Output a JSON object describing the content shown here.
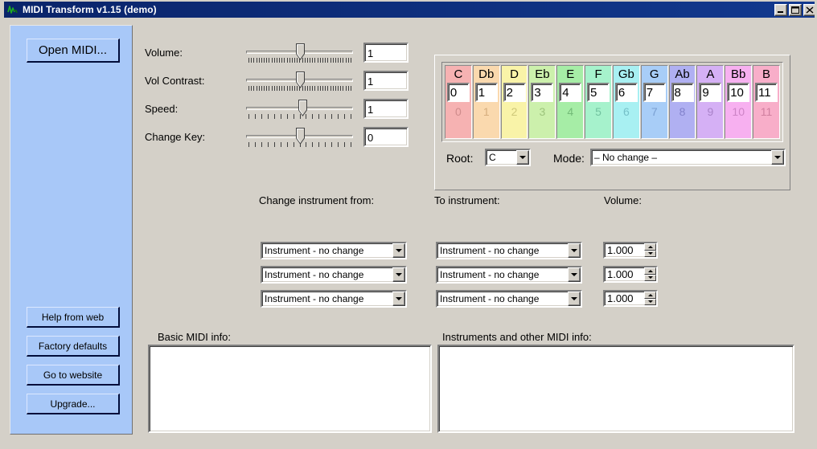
{
  "window": {
    "title": "MIDI Transform v1.15 (demo)",
    "icon": "waveform-icon",
    "minimize_label": "_",
    "maximize_label": "□",
    "close_label": "×",
    "titlebar_color": "#0a246a",
    "background_color": "#d4d0c8",
    "sidebar_color": "#a8c8f8"
  },
  "sidebar": {
    "open_midi_label": "Open MIDI...",
    "buttons": [
      {
        "label": "Help from web",
        "name": "help-from-web-button"
      },
      {
        "label": "Factory defaults",
        "name": "factory-defaults-button"
      },
      {
        "label": "Go to website",
        "name": "go-to-website-button"
      },
      {
        "label": "Upgrade...",
        "name": "upgrade-button"
      }
    ]
  },
  "sliders": [
    {
      "label": "Volume:",
      "value": "1",
      "ticks": 41,
      "thumb_pct": 50
    },
    {
      "label": "Vol Contrast:",
      "value": "1",
      "ticks": 41,
      "thumb_pct": 50
    },
    {
      "label": "Speed:",
      "value": "1",
      "ticks": 17,
      "thumb_pct": 53
    },
    {
      "label": "Change Key:",
      "value": "0",
      "ticks": 17,
      "thumb_pct": 50
    }
  ],
  "note_grid": {
    "notes": [
      {
        "name": "C",
        "value": "0",
        "shadow": "0",
        "color": "#f6b2b2",
        "shadow_color": "#cf8c8c"
      },
      {
        "name": "Db",
        "value": "1",
        "shadow": "1",
        "color": "#fad9ae",
        "shadow_color": "#d6ae7e"
      },
      {
        "name": "D",
        "value": "2",
        "shadow": "2",
        "color": "#f9f3a8",
        "shadow_color": "#cfc87a"
      },
      {
        "name": "Eb",
        "value": "3",
        "shadow": "3",
        "color": "#ccf0ac",
        "shadow_color": "#9dc47c"
      },
      {
        "name": "E",
        "value": "4",
        "shadow": "4",
        "color": "#a6eda6",
        "shadow_color": "#73bb78"
      },
      {
        "name": "F",
        "value": "5",
        "shadow": "5",
        "color": "#a6f2cc",
        "shadow_color": "#72c3a0"
      },
      {
        "name": "Gb",
        "value": "6",
        "shadow": "6",
        "color": "#a8f0f2",
        "shadow_color": "#76c0c8"
      },
      {
        "name": "G",
        "value": "7",
        "shadow": "7",
        "color": "#a8cdf7",
        "shadow_color": "#7ba0d2"
      },
      {
        "name": "Ab",
        "value": "8",
        "shadow": "8",
        "color": "#b0b0f2",
        "shadow_color": "#8282cc"
      },
      {
        "name": "A",
        "value": "9",
        "shadow": "9",
        "color": "#d5b0f5",
        "shadow_color": "#a982c9"
      },
      {
        "name": "Bb",
        "value": "10",
        "shadow": "10",
        "color": "#f7b0f0",
        "shadow_color": "#cd84c6"
      },
      {
        "name": "B",
        "value": "11",
        "shadow": "11",
        "color": "#f8aec9",
        "shadow_color": "#d07f9f"
      }
    ],
    "root_label": "Root:",
    "root_value": "C",
    "mode_label": "Mode:",
    "mode_value": "– No change –"
  },
  "instruments": {
    "from_header": "Change instrument from:",
    "to_header": "To instrument:",
    "volume_header": "Volume:",
    "rows": [
      {
        "from": "Instrument - no change",
        "to": "Instrument - no change",
        "volume": "1.000"
      },
      {
        "from": "Instrument - no change",
        "to": "Instrument - no change",
        "volume": "1.000"
      },
      {
        "from": "Instrument - no change",
        "to": "Instrument - no change",
        "volume": "1.000"
      }
    ]
  },
  "info_panels": {
    "basic_label": "Basic MIDI info:",
    "basic_value": "",
    "instruments_label": "Instruments and other MIDI info:",
    "instruments_value": ""
  }
}
